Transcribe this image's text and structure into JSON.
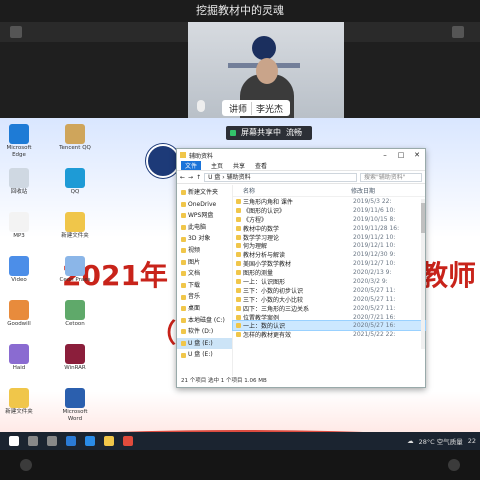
{
  "meeting": {
    "title": "挖掘教材中的灵魂",
    "speaker_role": "讲师",
    "speaker_name": "李光杰",
    "share_label": "屏幕共享中",
    "share_quality": "流畅"
  },
  "slide": {
    "title_left": "2021年",
    "title_right": "教师",
    "subtitle": "（中"
  },
  "explorer": {
    "window_title": "辅助资料",
    "ribbon": [
      "文件",
      "主页",
      "共享",
      "查看"
    ],
    "address": "U 盘 › 辅助资料",
    "search_placeholder": "搜索\"辅助资料\"",
    "columns": {
      "name": "名称",
      "date": "修改日期"
    },
    "nav": [
      {
        "label": "新建文件夹",
        "selected": false
      },
      {
        "label": "OneDrive",
        "selected": false
      },
      {
        "label": "WPS网盘",
        "selected": false
      },
      {
        "label": "此电脑",
        "selected": false
      },
      {
        "label": "3D 对象",
        "selected": false
      },
      {
        "label": "视频",
        "selected": false
      },
      {
        "label": "图片",
        "selected": false
      },
      {
        "label": "文档",
        "selected": false
      },
      {
        "label": "下载",
        "selected": false
      },
      {
        "label": "音乐",
        "selected": false
      },
      {
        "label": "桌面",
        "selected": false
      },
      {
        "label": "本地磁盘 (C:)",
        "selected": false
      },
      {
        "label": "软件 (D:)",
        "selected": false
      },
      {
        "label": "U 盘 (E:)",
        "selected": true
      },
      {
        "label": "U 盘 (E:)",
        "selected": false
      }
    ],
    "files": [
      {
        "name": "三角形内角和 课件",
        "date": "2019/5/3 22:",
        "selected": false
      },
      {
        "name": "《图形的认识》",
        "date": "2019/11/6 10:",
        "selected": false
      },
      {
        "name": "《方程》",
        "date": "2019/10/15 8:",
        "selected": false
      },
      {
        "name": "教材中的数学",
        "date": "2019/11/28 16:",
        "selected": false
      },
      {
        "name": "数学学习理论",
        "date": "2019/11/2 10:",
        "selected": false
      },
      {
        "name": "何为理解",
        "date": "2019/12/1 10:",
        "selected": false
      },
      {
        "name": "教材分析与解读",
        "date": "2019/12/30 9:",
        "selected": false
      },
      {
        "name": "美国小学数学教材",
        "date": "2019/12/7 10:",
        "selected": false
      },
      {
        "name": "图形的测量",
        "date": "2020/2/13 9:",
        "selected": false
      },
      {
        "name": "一上：认识图形",
        "date": "2020/3/2 9:",
        "selected": false
      },
      {
        "name": "三下：小数的初步认识",
        "date": "2020/5/27 11:",
        "selected": false
      },
      {
        "name": "三下：小数的大小比较",
        "date": "2020/5/27 11:",
        "selected": false
      },
      {
        "name": "四下：三角形的三边关系",
        "date": "2020/5/27 11:",
        "selected": false
      },
      {
        "name": "位置教学案例",
        "date": "2020/7/21 16:",
        "selected": false
      },
      {
        "name": "一上：数的认识",
        "date": "2020/5/27 16:",
        "selected": true
      },
      {
        "name": "怎样的教材更有效",
        "date": "2021/5/22 22:",
        "selected": false
      }
    ],
    "status": "21 个项目    选中 1 个项目 1.06 MB"
  },
  "desktop_icons": [
    {
      "label": "Microsoft Edge",
      "color": "#1e7bd6"
    },
    {
      "label": "Tencent QQ",
      "color": "#cfa55b"
    },
    {
      "label": "回收站",
      "color": "#cfd8e2"
    },
    {
      "label": "QQ",
      "color": "#1e9bd6"
    },
    {
      "label": "MP3",
      "color": "#f3f3f3"
    },
    {
      "label": "新建文件夹",
      "color": "#f0c64a"
    },
    {
      "label": "Video",
      "color": "#4c8ee8"
    },
    {
      "label": "Ceon Praes",
      "color": "#8bb6e8"
    },
    {
      "label": "Goodwill",
      "color": "#e88b3c"
    },
    {
      "label": "Cetoon",
      "color": "#5fa96a"
    },
    {
      "label": "Haid",
      "color": "#8a6bd1"
    },
    {
      "label": "WinRAR",
      "color": "#8b1e3b"
    },
    {
      "label": "新建文件夹",
      "color": "#f0c64a"
    },
    {
      "label": "Microsoft Word",
      "color": "#2b5fae"
    }
  ],
  "taskbar": {
    "weather": "28°C 空气质量",
    "time": "22"
  },
  "colors": {
    "accent": "#1a73d9",
    "slide_red": "#c8231a",
    "selected_row": "#cce8ff"
  }
}
